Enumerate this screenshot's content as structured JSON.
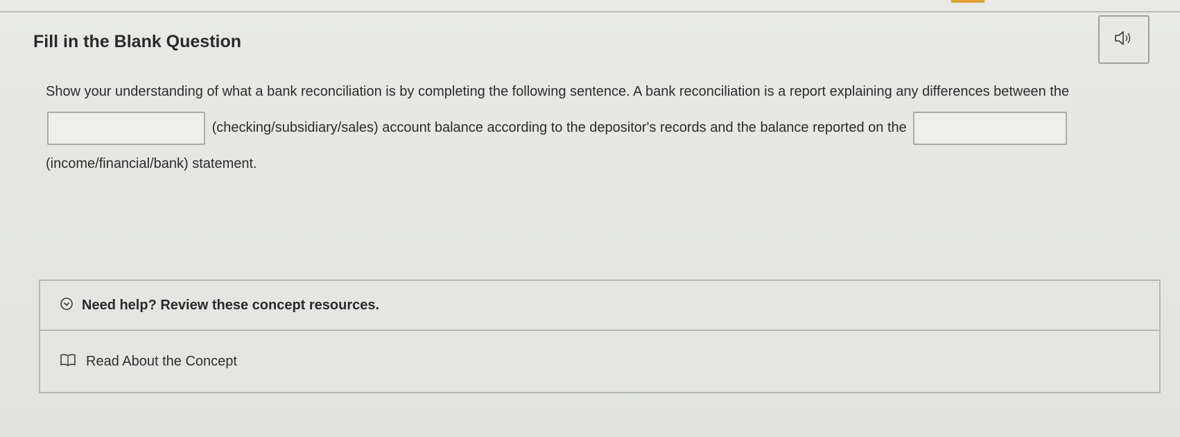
{
  "question": {
    "title": "Fill in the Blank Question",
    "prompt_part1": "Show your understanding of what a bank reconciliation is by completing the following sentence. A bank reconciliation is a report explaining any differences between the",
    "blank1_value": "",
    "prompt_part2": "(checking/subsidiary/sales) account balance according to the depositor's records and the balance reported on the",
    "blank2_value": "",
    "prompt_part3": "(income/financial/bank) statement."
  },
  "toolbar": {
    "audio_icon": "speaker-icon"
  },
  "help": {
    "header_icon": "chevron-down-circle-icon",
    "header_label": "Need help? Review these concept resources.",
    "link_icon": "book-icon",
    "link_label": "Read About the Concept"
  }
}
